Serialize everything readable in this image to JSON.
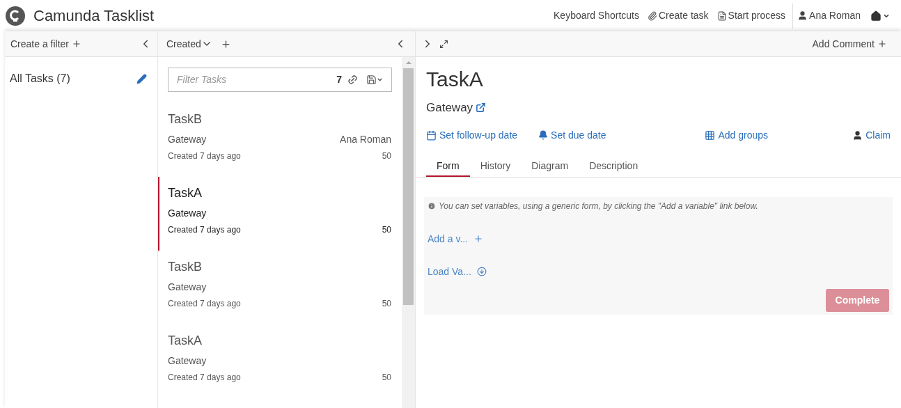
{
  "app": {
    "title": "Camunda Tasklist"
  },
  "header_links": [
    {
      "kind": "text",
      "label": "Keyboard Shortcuts"
    },
    {
      "kind": "attach",
      "label": "Create task"
    },
    {
      "kind": "list",
      "label": "Start process"
    },
    {
      "kind": "user",
      "label": "Ana Roman"
    },
    {
      "kind": "home"
    }
  ],
  "filters": {
    "create_label": "Create a filter",
    "items": [
      {
        "label": "All Tasks (7)",
        "selected": true
      }
    ]
  },
  "list": {
    "sort_label": "Created",
    "search": {
      "placeholder": "Filter Tasks",
      "count": "7"
    },
    "tasks": [
      {
        "name": "TaskB",
        "process": "Gateway",
        "assignee": "Ana Roman",
        "created": "Created 7 days ago",
        "priority": "50",
        "selected": false
      },
      {
        "name": "TaskA",
        "process": "Gateway",
        "created": "Created 7 days ago",
        "priority": "50",
        "selected": true
      },
      {
        "name": "TaskB",
        "process": "Gateway",
        "created": "Created 7 days ago",
        "priority": "50",
        "selected": false
      },
      {
        "name": "TaskA",
        "process": "Gateway",
        "created": "Created 7 days ago",
        "priority": "50",
        "selected": false
      }
    ]
  },
  "detail": {
    "add_comment": "Add Comment",
    "title": "TaskA",
    "process": "Gateway",
    "actions": [
      {
        "kind": "calendar",
        "label": "Set follow-up date"
      },
      {
        "kind": "bell",
        "label": "Set due date"
      },
      {
        "kind": "grid",
        "label": "Add groups"
      },
      {
        "kind": "user",
        "label": "Claim"
      }
    ],
    "tabs": [
      {
        "label": "Form",
        "selected": true
      },
      {
        "label": "History",
        "selected": false
      },
      {
        "label": "Diagram",
        "selected": false
      },
      {
        "label": "Description",
        "selected": false
      }
    ],
    "form": {
      "hint": "You can set variables, using a generic form, by clicking the \"Add a variable\" link below.",
      "links": [
        {
          "kind": "add",
          "label": "Add a v..."
        },
        {
          "kind": "load",
          "label": "Load Va..."
        }
      ],
      "complete": {
        "label": "Complete",
        "disabled": true
      }
    }
  }
}
